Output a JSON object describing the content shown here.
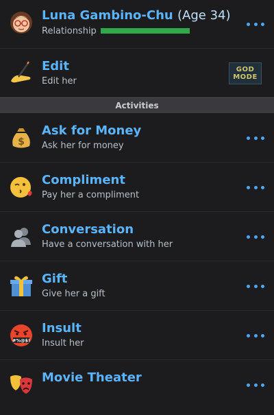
{
  "header": {
    "name": "Luna Gambino-Chu",
    "age": "(Age 34)",
    "relationship_label": "Relationship",
    "relationship_level": 1.0,
    "relationship_color": "#2fa84a",
    "avatar_icon": "woman-avatar-icon"
  },
  "edit": {
    "title": "Edit",
    "subtitle": "Edit her",
    "icon": "writing-hand-icon",
    "badge_line1": "GOD",
    "badge_line2": "MODE"
  },
  "section_title": "Activities",
  "activities": [
    {
      "title": "Ask for Money",
      "subtitle": "Ask her for money",
      "icon": "money-bag-icon"
    },
    {
      "title": "Compliment",
      "subtitle": "Pay her a compliment",
      "icon": "kissing-face-icon"
    },
    {
      "title": "Conversation",
      "subtitle": "Have a conversation with her",
      "icon": "people-silhouette-icon"
    },
    {
      "title": "Gift",
      "subtitle": "Give her a gift",
      "icon": "gift-icon"
    },
    {
      "title": "Insult",
      "subtitle": "Insult her",
      "icon": "cursing-face-icon"
    },
    {
      "title": "Movie Theater",
      "subtitle": "",
      "icon": "theater-masks-icon"
    }
  ],
  "accent_color": "#5ab4ff"
}
